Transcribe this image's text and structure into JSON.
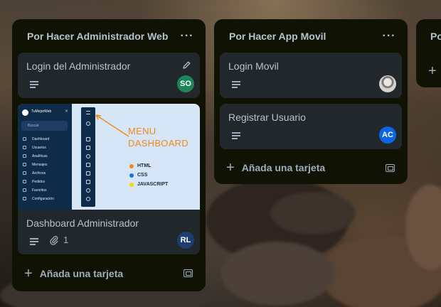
{
  "colors": {
    "list_bg": "#101204",
    "card_bg": "#22272b",
    "text": "#b6c2cf",
    "muted": "#9fadbc",
    "annotation": "#f28a1b"
  },
  "lists": [
    {
      "title": "Por Hacer Administrador Web",
      "menu_icon": "more-horizontal-icon",
      "cards": [
        {
          "title": "Login del Administrador",
          "has_description": true,
          "edit_icon": "pencil-icon",
          "member": {
            "initials": "SO",
            "color": "#1f845a"
          }
        },
        {
          "title": "Dashboard Administrador",
          "has_description": true,
          "attachments": "1",
          "member": {
            "initials": "RL",
            "color": "#1d3e70"
          },
          "cover": {
            "brand": "TuMejorWeb",
            "search_placeholder": "Buscar",
            "menu_items": [
              "Dashboard",
              "Usuarios",
              "Analíticas",
              "Mensajes",
              "Archivos",
              "Pedidos",
              "Favoritos",
              "Configuración"
            ],
            "annotation_line1": "MENU",
            "annotation_line2": "DASHBOARD",
            "legend": [
              {
                "label": "HTML",
                "color": "#f28a1b"
              },
              {
                "label": "CSS",
                "color": "#1d6fe0"
              },
              {
                "label": "JAVASCRIPT",
                "color": "#f5d90a"
              }
            ]
          }
        }
      ],
      "add_card_label": "Añada una tarjeta"
    },
    {
      "title": "Por Hacer App Movil",
      "menu_icon": "more-horizontal-icon",
      "cards": [
        {
          "title": "Login Movil",
          "has_description": true,
          "member": {
            "initials": "",
            "color": "#c7cdd3",
            "photo": true
          }
        },
        {
          "title": "Registrar Usuario",
          "has_description": true,
          "member": {
            "initials": "AC",
            "color": "#0c66e4"
          }
        }
      ],
      "add_card_label": "Añada una tarjeta"
    },
    {
      "title": "Po",
      "add_card_label": ""
    }
  ]
}
